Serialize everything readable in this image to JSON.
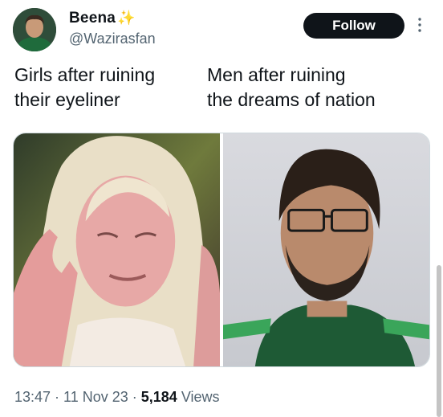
{
  "author": {
    "display_name": "Beena",
    "badge": "✨",
    "handle": "@Wazirasfan",
    "avatar_icon": "profile-photo"
  },
  "actions": {
    "follow_label": "Follow",
    "more_icon": "more-options-icon"
  },
  "tweet": {
    "caption_left": "Girls after ruining\ntheir eyeliner",
    "caption_right": "Men after ruining\nthe dreams of nation"
  },
  "media": {
    "left_image": "crying-blonde-woman-photo",
    "right_image": "bearded-cricketer-in-green-jersey-photo"
  },
  "meta": {
    "time": "13:47",
    "separator": " · ",
    "date": "11 Nov 23",
    "views_count": "5,184",
    "views_label": " Views"
  },
  "colors": {
    "primary_text": "#0f1419",
    "secondary_text": "#536471",
    "follow_bg": "#0f1419",
    "border": "#cfd9de"
  }
}
